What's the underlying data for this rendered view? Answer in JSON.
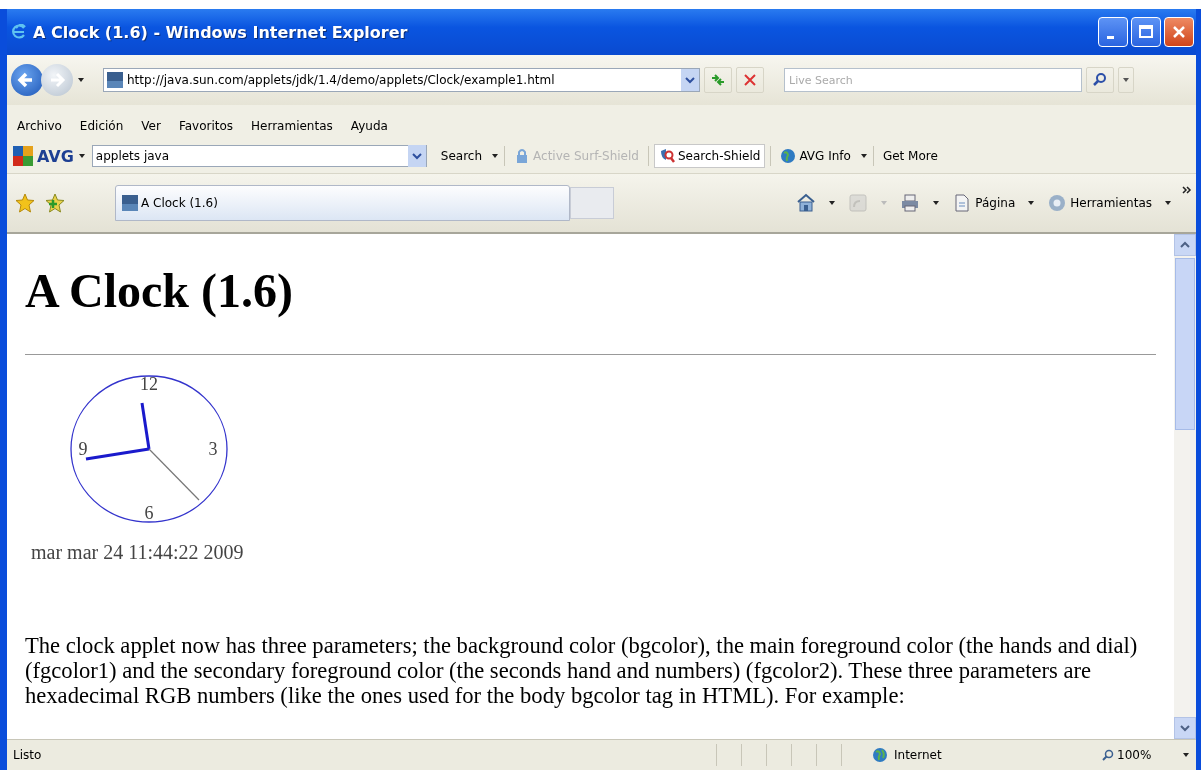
{
  "window": {
    "title": "A Clock (1.6) - Windows Internet Explorer"
  },
  "address_bar": {
    "url": "http://java.sun.com/applets/jdk/1.4/demo/applets/Clock/example1.html"
  },
  "search": {
    "placeholder": "Live Search"
  },
  "menu": [
    "Archivo",
    "Edición",
    "Ver",
    "Favoritos",
    "Herramientas",
    "Ayuda"
  ],
  "avg_toolbar": {
    "logo": "AVG",
    "query": "applets java",
    "items": [
      {
        "label": "Search",
        "dropdown": true,
        "disabled": false,
        "kind": "plain"
      },
      {
        "label": "Active Surf-Shield",
        "dropdown": false,
        "disabled": true,
        "kind": "shield"
      },
      {
        "label": "Search-Shield",
        "dropdown": false,
        "disabled": false,
        "kind": "search-shield"
      },
      {
        "label": "AVG Info",
        "dropdown": true,
        "disabled": false,
        "kind": "info"
      },
      {
        "label": "Get More",
        "dropdown": false,
        "disabled": false,
        "kind": "plain"
      }
    ]
  },
  "tabs": [
    {
      "label": "A Clock (1.6)",
      "selected": true
    }
  ],
  "command_bar": [
    {
      "kind": "home",
      "dropdown": true,
      "disabled": false
    },
    {
      "kind": "feed",
      "dropdown": true,
      "disabled": true
    },
    {
      "kind": "print",
      "dropdown": true,
      "disabled": false
    },
    {
      "kind": "page",
      "label": "Página",
      "dropdown": true,
      "disabled": false
    },
    {
      "kind": "tools",
      "label": "Herramientas",
      "dropdown": true,
      "disabled": false
    }
  ],
  "page": {
    "heading": "A Clock (1.6)",
    "clock": {
      "numerals": [
        "12",
        "3",
        "6",
        "9"
      ],
      "date": "mar mar 24 11:44:22 2009"
    },
    "paragraph": "The clock applet now has three parameters; the background color (bgcolor), the main foreground color (the hands and dial) (fgcolor1) and the secondary foreground color (the seconds hand and numbers) (fgcolor2). These three parameters are hexadecimal RGB numbers (like the ones used for the body bgcolor tag in HTML). For example:"
  },
  "status_bar": {
    "text": "Listo",
    "zone": "Internet",
    "zoom": "100%"
  }
}
